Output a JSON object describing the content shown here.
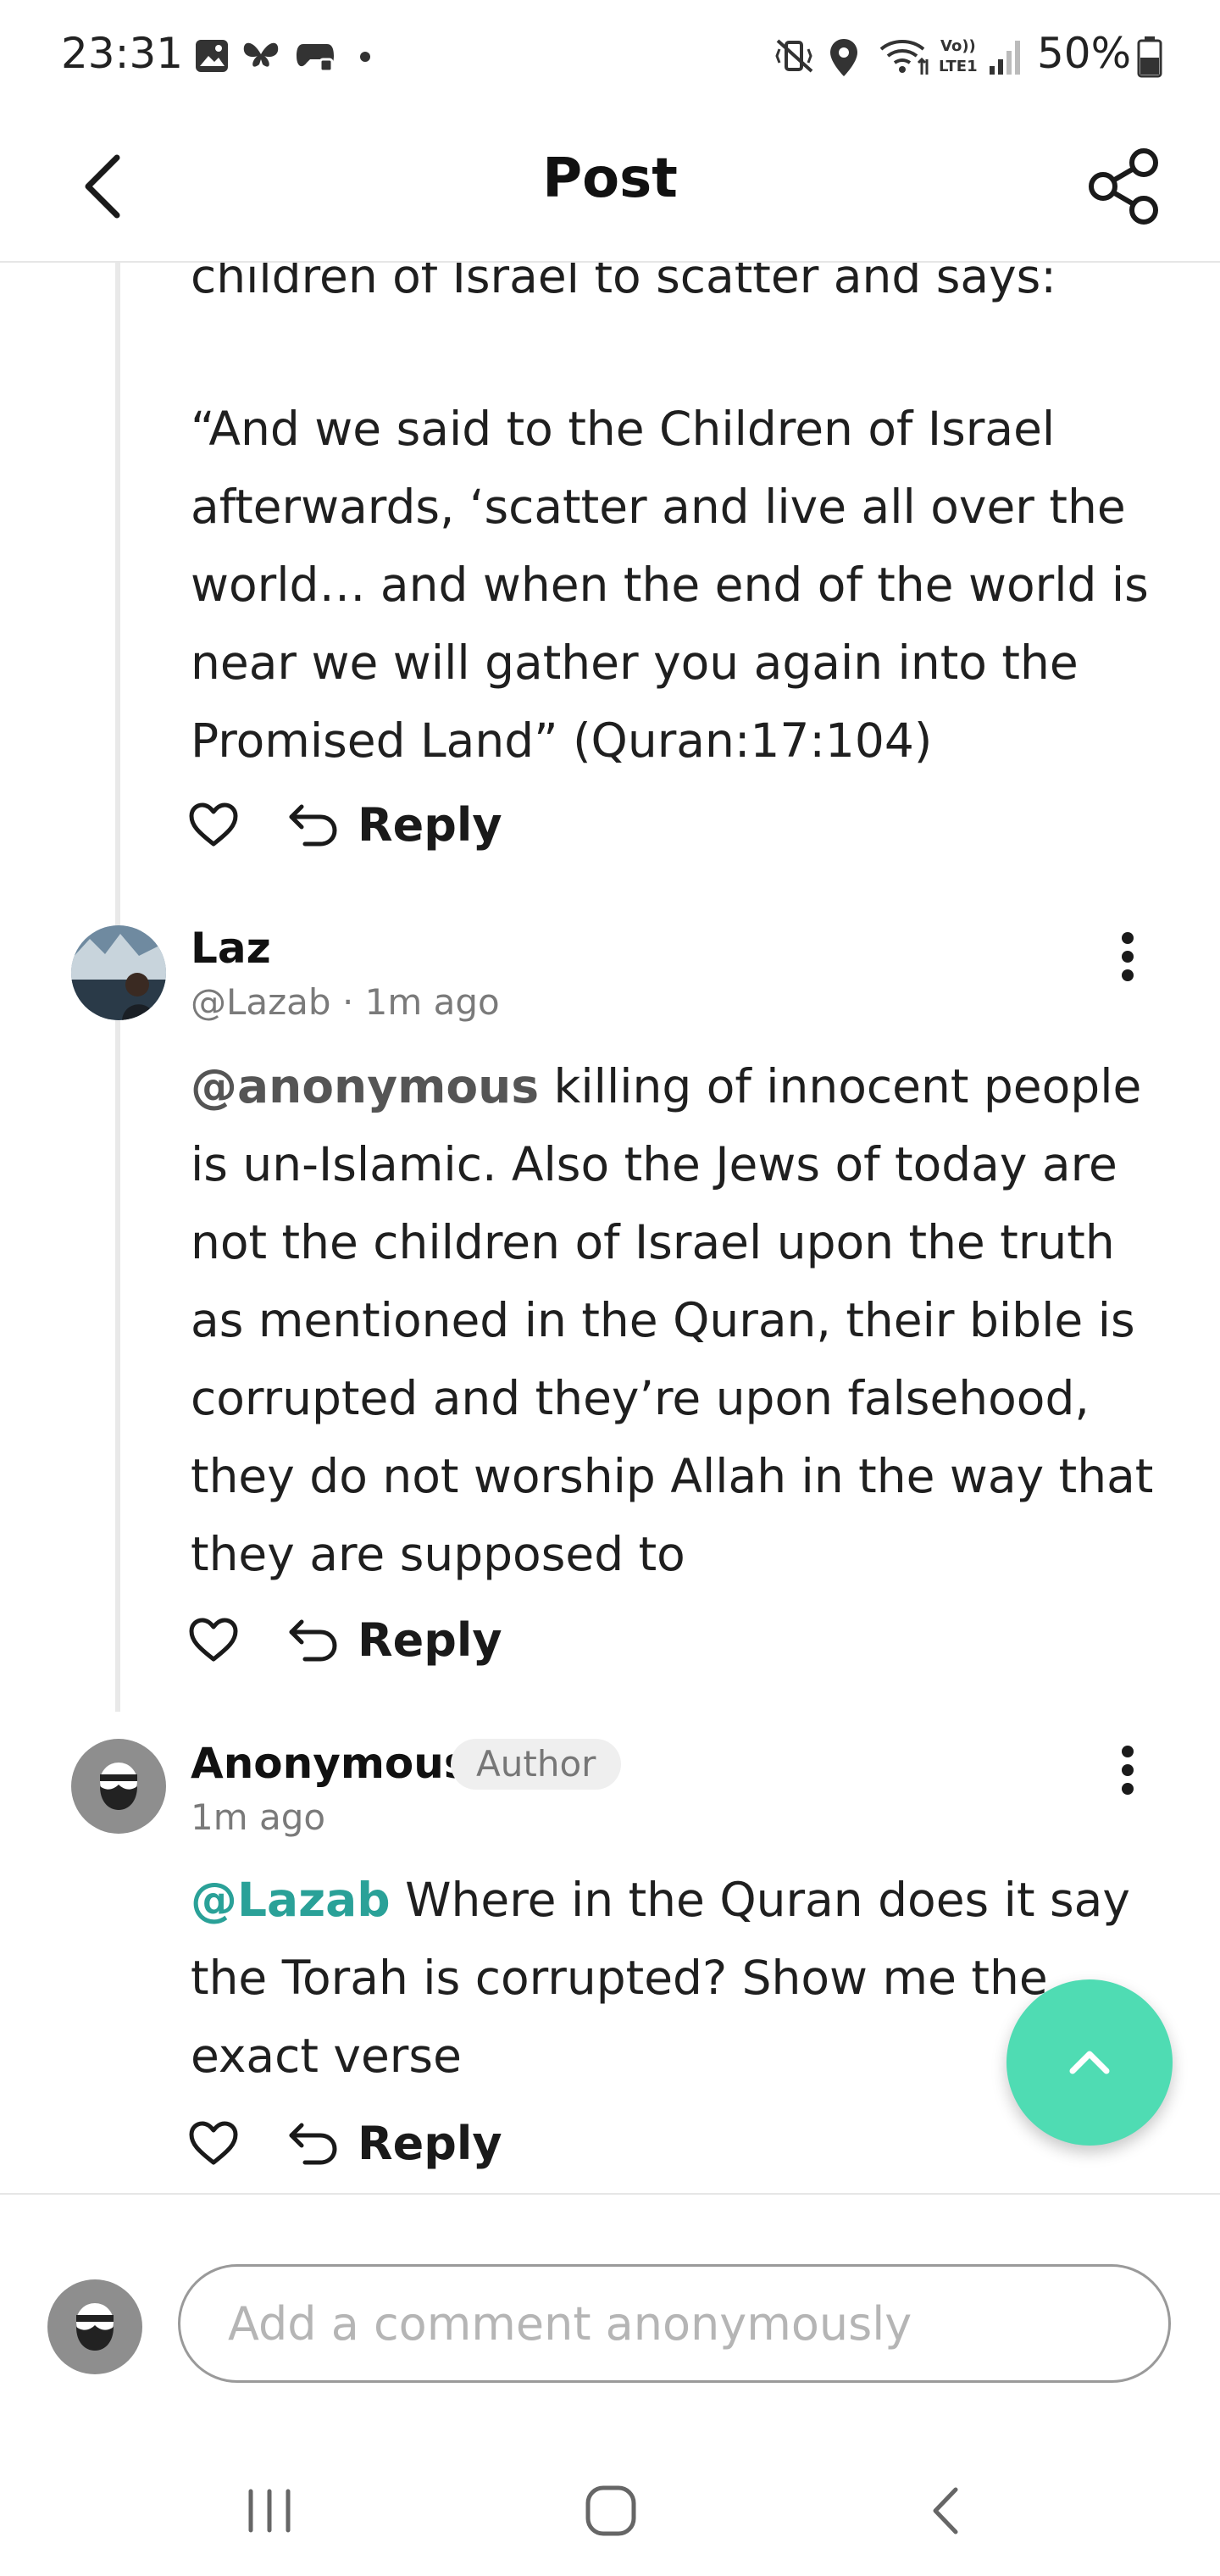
{
  "status_bar": {
    "time": "23:31",
    "battery": "50%"
  },
  "header": {
    "title": "Post"
  },
  "comments": [
    {
      "text_top": "children of Israel to scatter and says:",
      "text_quote": "“And we said to the Children of Israel afterwards, ‘scatter and live all over the world… and when the end of the world is near we will gather you again into the Promised Land” (Quran:17:104)",
      "reply_label": "Reply"
    },
    {
      "author": "Laz",
      "handle": "@Lazab",
      "time": "1m ago",
      "mention": "@anonymous",
      "text": " killing of innocent people is un-Islamic. Also the Jews of today are not the children of Israel upon the truth as mentioned in the Quran, their bible is corrupted and they’re upon falsehood, they do not worship Allah in the way that they are supposed to",
      "reply_label": "Reply"
    },
    {
      "author": "Anonymous",
      "badge": "Author",
      "time": "1m ago",
      "mention": "@Lazab",
      "text": " Where in the Quran does it say the Torah is corrupted? Show me the exact verse",
      "reply_label": "Reply"
    }
  ],
  "composer": {
    "placeholder": "Add a comment anonymously"
  },
  "colors": {
    "accent": "#4fdcb3",
    "mention": "#2aa198"
  }
}
